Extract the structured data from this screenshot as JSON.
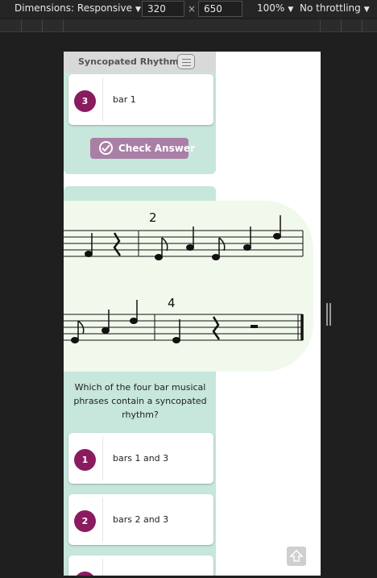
{
  "toolbar": {
    "device": "Dimensions: Responsive",
    "width": "320",
    "height": "650",
    "zoom": "100%",
    "throttle": "No throttling"
  },
  "lesson": {
    "title": "Syncopated Rhythms",
    "top_option": {
      "number": "3",
      "label": "bar 1"
    },
    "check_button": "Check Answer",
    "score": {
      "measure_numbers": [
        "2",
        "4"
      ]
    },
    "question": "Which of the four bar musical phrases contain a syncopated rhythm?",
    "options": [
      {
        "number": "1",
        "label": "bars 1 and 3"
      },
      {
        "number": "2",
        "label": "bars 2 and 3"
      }
    ]
  },
  "colors": {
    "panel": "#c7e6dc",
    "accent": "#8a1b5f",
    "check_button": "#a97fa6",
    "score_bg": "#f1f9ec"
  }
}
